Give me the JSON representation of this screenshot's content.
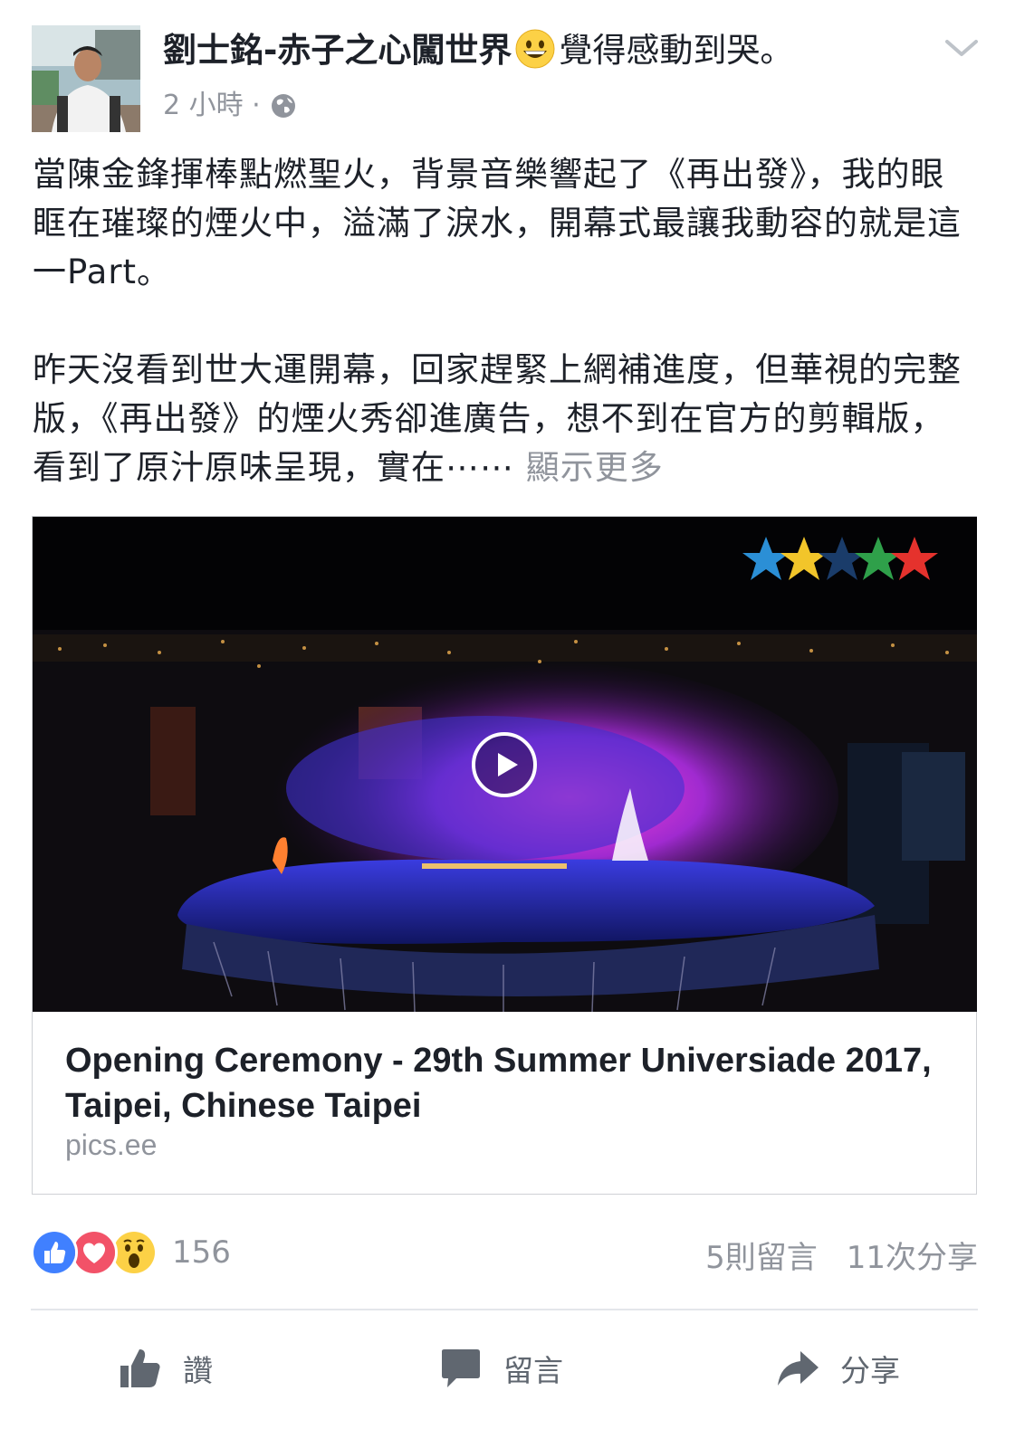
{
  "post": {
    "author": "劉士銘-赤子之心闖世界",
    "feeling": "覺得感動到哭。",
    "time": "2 小時 ·",
    "paragraph1": "當陳金鋒揮棒點燃聖火，背景音樂響起了《再出發》，我的眼眶在璀璨的煙火中，溢滿了淚水，開幕式最讓我動容的就是這一Part。",
    "paragraph2": "昨天沒看到世大運開幕，回家趕緊上網補進度，但華視的完整版，《再出發》的煙火秀卻進廣告，想不到在官方的剪輯版，看到了原汁原味呈現，實在⋯⋯",
    "see_more": "顯示更多"
  },
  "link_card": {
    "title": "Opening Ceremony - 29th Summer Universiade 2017, Taipei, Chinese Taipei",
    "domain": "pics.ee"
  },
  "stats": {
    "reaction_count": "156",
    "comments": "5則留言",
    "shares": "11次分享"
  },
  "actions": {
    "like": "讚",
    "comment": "留言",
    "share": "分享"
  },
  "icons": {
    "header": [
      "avatar",
      "grinning-face-emoji",
      "chevron-down-icon",
      "globe-icon"
    ],
    "reactions": [
      "like-reaction-icon",
      "love-reaction-icon",
      "wow-reaction-icon"
    ],
    "actions": [
      "thumbs-up-icon",
      "comment-bubble-icon",
      "share-arrow-icon"
    ],
    "video": [
      "play-icon",
      "universiade-stars-logo"
    ]
  },
  "colors": {
    "text": "#1d2129",
    "secondary": "#90949c",
    "like_blue": "#4080ff",
    "love_red": "#f25268",
    "wow_yellow": "#fcd146"
  }
}
